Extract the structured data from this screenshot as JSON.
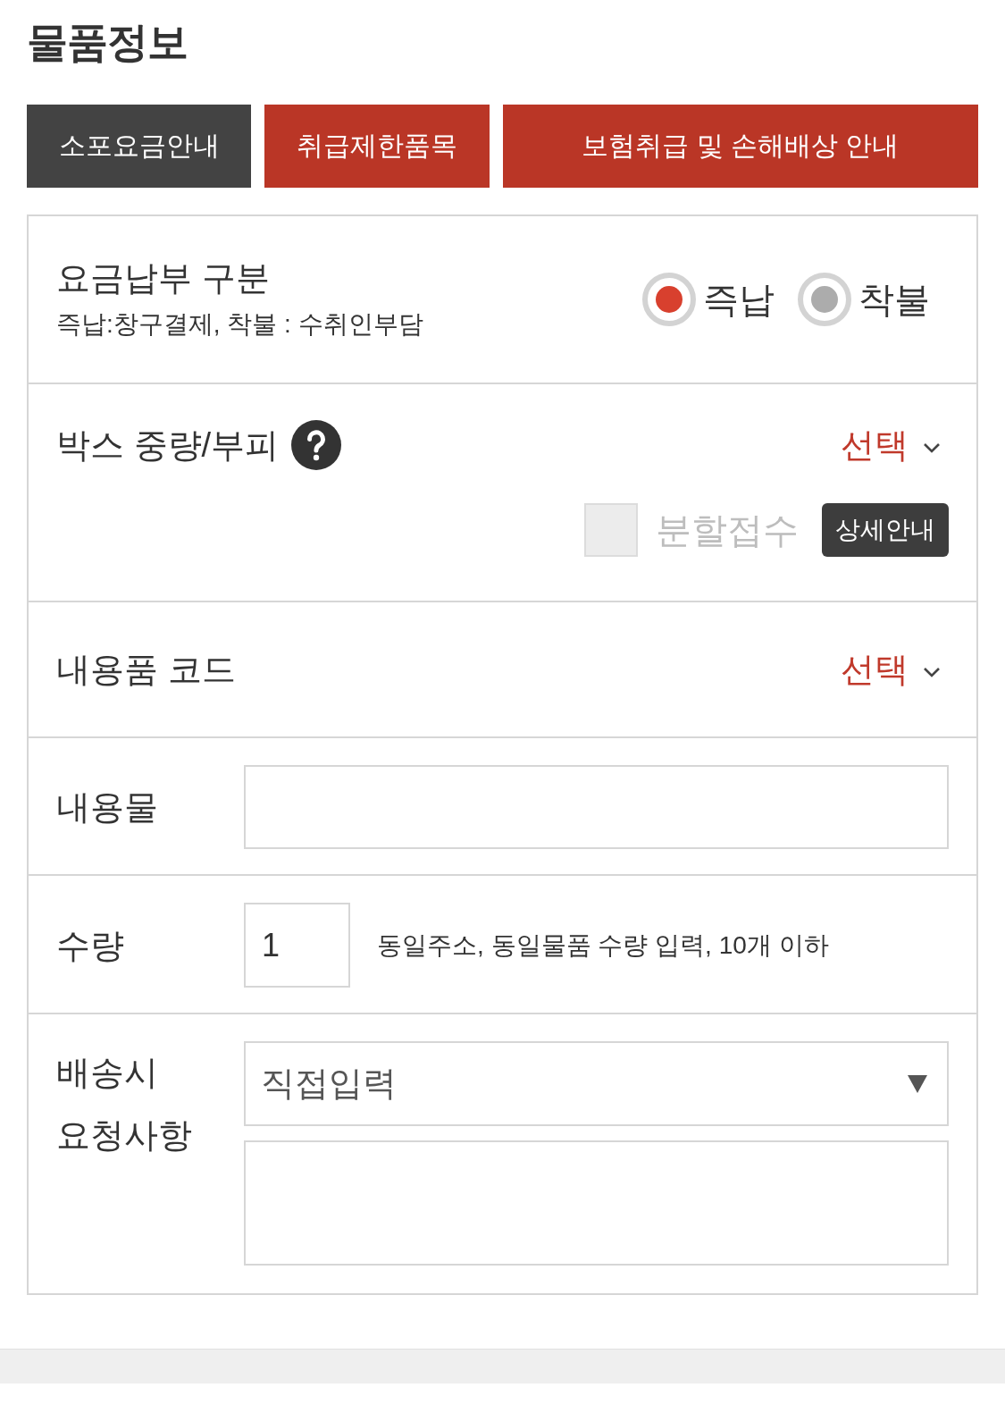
{
  "title": "물품정보",
  "tabs": [
    {
      "label": "소포요금안내",
      "selected": true
    },
    {
      "label": "취급제한품목",
      "selected": false
    },
    {
      "label": "보험취급 및 손해배상 안내",
      "selected": false
    }
  ],
  "sections": [
    {
      "kind": "radio",
      "label": "요금납부 구분",
      "note": "즉납:창구결제, 착불 : 수취인부담",
      "options": [
        {
          "label": "즉납",
          "selected": true
        },
        {
          "label": "착불",
          "selected": false
        }
      ]
    },
    {
      "kind": "picker",
      "label": "박스 중량/부피",
      "help": true,
      "picker": "선택",
      "split": {
        "label": "분할접수",
        "checked": false,
        "disabled": true
      },
      "detail_button": "상세안내"
    },
    {
      "kind": "picker",
      "label": "내용품 코드",
      "picker": "선택"
    },
    {
      "kind": "text",
      "label": "내용물"
    },
    {
      "kind": "quantity",
      "label": "수량",
      "value": "1",
      "hint": "동일주소, 동일물품 수량 입력, 10개 이하"
    },
    {
      "kind": "request",
      "label": "배송시 요청사항",
      "select": "직접입력"
    }
  ]
}
